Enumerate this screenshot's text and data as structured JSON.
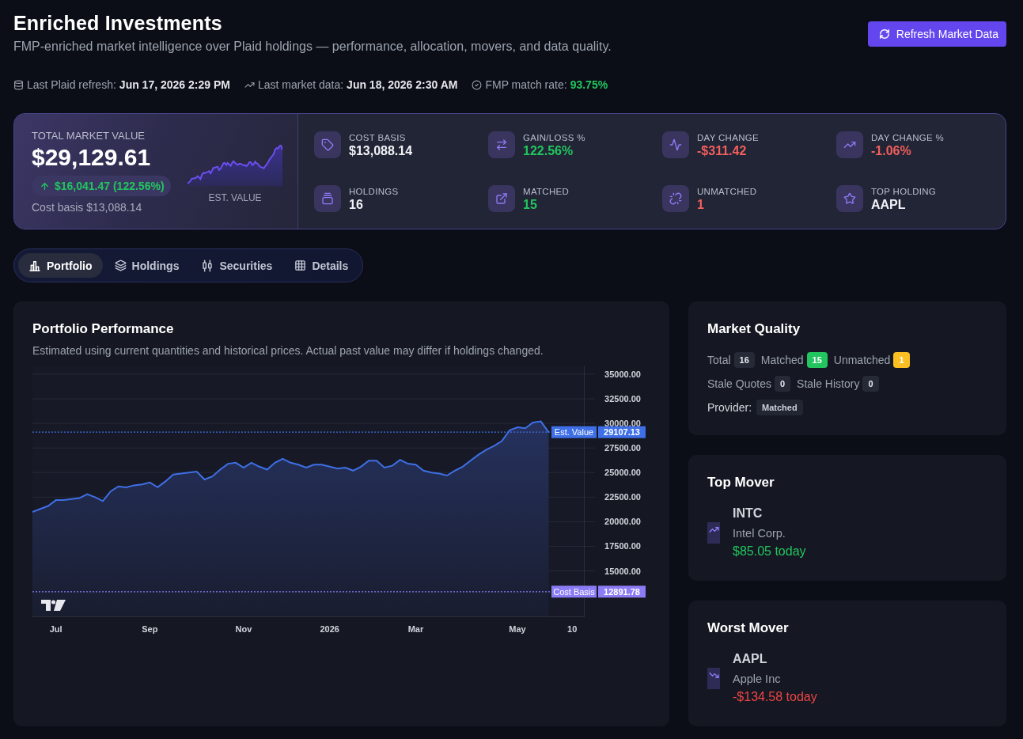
{
  "header": {
    "title": "Enriched Investments",
    "subtitle": "FMP-enriched market intelligence over Plaid holdings — performance, allocation, movers, and data quality.",
    "refresh_button": "Refresh Market Data"
  },
  "meta": [
    {
      "kind": "plaid",
      "label": "Last Plaid refresh:",
      "value": "Jun 17, 2026 2:29 PM",
      "color": "#e5e7eb"
    },
    {
      "kind": "market",
      "label": "Last market data:",
      "value": "Jun 18, 2026 2:30 AM",
      "color": "#e5e7eb"
    },
    {
      "kind": "match",
      "label": "FMP match rate:",
      "value": "93.75%",
      "color": "#22c55e"
    }
  ],
  "summary": {
    "total": {
      "label": "TOTAL MARKET VALUE",
      "value": "$29,129.61",
      "change": "$16,041.47 (122.56%)",
      "gain": true,
      "cost_basis": "Cost basis $13,088.14",
      "sparkline_label": "EST. VALUE"
    },
    "metrics": [
      {
        "kind": "tag",
        "label": "COST BASIS",
        "value": "$13,088.14",
        "color": "#f1f2f6"
      },
      {
        "kind": "swap",
        "label": "GAIN/LOSS %",
        "value": "122.56%",
        "color": "#22c55e"
      },
      {
        "kind": "pulse",
        "label": "DAY CHANGE",
        "value": "-$311.42",
        "color": "#f25f5c"
      },
      {
        "kind": "trend",
        "label": "DAY CHANGE %",
        "value": "-1.06%",
        "color": "#f25f5c"
      },
      {
        "kind": "stack",
        "label": "HOLDINGS",
        "value": "16",
        "color": "#f1f2f6"
      },
      {
        "kind": "link",
        "label": "MATCHED",
        "value": "15",
        "color": "#22c55e"
      },
      {
        "kind": "unlink",
        "label": "UNMATCHED",
        "value": "1",
        "color": "#f25f5c"
      },
      {
        "kind": "star",
        "label": "TOP HOLDING",
        "value": "AAPL",
        "color": "#f1f2f6"
      }
    ]
  },
  "tabs": [
    {
      "label": "Portfolio",
      "kind": "chart",
      "selected": true
    },
    {
      "label": "Holdings",
      "kind": "layers",
      "selected": false
    },
    {
      "label": "Securities",
      "kind": "candles",
      "selected": false
    },
    {
      "label": "Details",
      "kind": "table",
      "selected": false
    }
  ],
  "performance": {
    "title": "Portfolio Performance",
    "note": "Estimated using current quantities and historical prices. Actual past value may differ if holdings changed.",
    "chart_data": {
      "type": "area",
      "categories": [
        null,
        null,
        null,
        "Jul",
        null,
        null,
        null,
        null,
        null,
        null,
        null,
        null,
        null,
        null,
        null,
        "Sep",
        null,
        null,
        null,
        null,
        null,
        null,
        null,
        null,
        null,
        null,
        null,
        "Nov",
        null,
        null,
        null,
        null,
        null,
        null,
        null,
        null,
        null,
        null,
        "2026",
        null,
        null,
        null,
        null,
        null,
        null,
        null,
        null,
        null,
        null,
        "Mar",
        null,
        null,
        null,
        null,
        null,
        null,
        null,
        null,
        null,
        null,
        null,
        null,
        "May",
        null,
        null,
        null,
        null,
        null,
        null,
        "10"
      ],
      "series": [
        {
          "color": "#3e6fe6",
          "values": [
            21000,
            21300,
            21600,
            22200,
            22200,
            22300,
            22400,
            22800,
            22500,
            22100,
            23100,
            23600,
            23500,
            23700,
            23800,
            24000,
            23500,
            24100,
            24800,
            24900,
            25000,
            25100,
            24300,
            24600,
            25300,
            25900,
            26000,
            25500,
            26000,
            25600,
            25300,
            26000,
            26400,
            26000,
            25800,
            25500,
            25800,
            25800,
            25600,
            25400,
            25500,
            25200,
            25600,
            26200,
            26200,
            25500,
            25700,
            26300,
            25900,
            25800,
            25200,
            25000,
            24900,
            24700,
            25200,
            25600,
            26200,
            26800,
            27300,
            27700,
            28200,
            29300,
            29600,
            29500,
            30100,
            30200,
            29100,
            null,
            null,
            null
          ]
        }
      ],
      "yticks": [
        {
          "value": 15000,
          "label": "15000.00"
        },
        {
          "value": 17500,
          "label": "17500.00"
        },
        {
          "value": 20000,
          "label": "20000.00"
        },
        {
          "value": 22500,
          "label": "22500.00"
        },
        {
          "value": 25000,
          "label": "25000.00"
        },
        {
          "value": 27500,
          "label": "27500.00"
        },
        {
          "value": 30000,
          "label": "30000.00"
        },
        {
          "value": 32500,
          "label": "32500.00"
        },
        {
          "value": 35000,
          "label": "35000.00"
        }
      ],
      "ylim": [
        10300,
        35800
      ],
      "grid": true,
      "ref_lines": [
        {
          "axis": "y",
          "value": 29107.13,
          "label": "Est. Value",
          "color": "#3e6fe6"
        },
        {
          "axis": "y",
          "value": 12891.78,
          "label": "Cost Basis",
          "color": "#8b7cf6"
        }
      ],
      "annotations": [
        "29107.13",
        "12891.78"
      ]
    }
  },
  "market_quality": {
    "title": "Market Quality",
    "rows": [
      {
        "items": [
          {
            "label": "Total",
            "count": "16",
            "color": "#262a37"
          },
          {
            "label": "Matched",
            "count": "15",
            "color": "#22c55e"
          },
          {
            "label": "Unmatched",
            "count": "1",
            "color": "#fbbf24"
          }
        ]
      },
      {
        "items": [
          {
            "label": "Stale Quotes",
            "count": "0",
            "color": "#262a37"
          },
          {
            "label": "Stale History",
            "count": "0",
            "color": "#262a37"
          }
        ]
      }
    ],
    "provider": {
      "label": "Provider:",
      "value": "Matched"
    }
  },
  "movers": [
    {
      "kind": "up",
      "title": "Top Mover",
      "symbol": "INTC",
      "name": "Intel Corp.",
      "change": "$85.05 today"
    },
    {
      "kind": "down",
      "title": "Worst Mover",
      "symbol": "AAPL",
      "name": "Apple Inc",
      "change": "-$134.58 today"
    }
  ]
}
